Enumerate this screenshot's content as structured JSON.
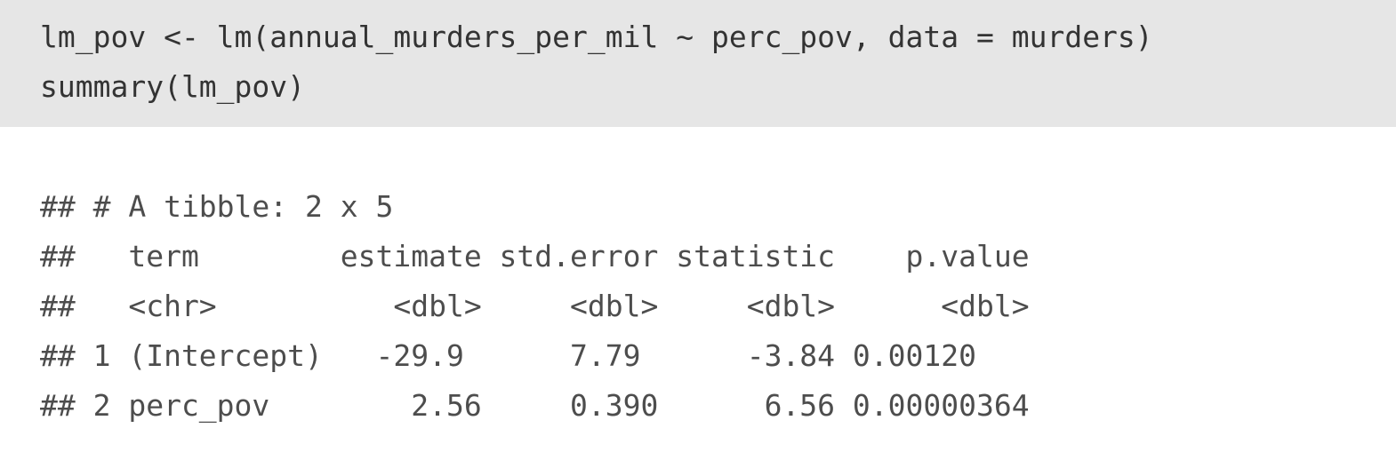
{
  "code": {
    "lines": [
      "lm_pov <- lm(annual_murders_per_mil ~ perc_pov, data = murders)",
      "summary(lm_pov)"
    ]
  },
  "output": {
    "lines": [
      "## # A tibble: 2 x 5",
      "##   term        estimate std.error statistic    p.value",
      "##   <chr>          <dbl>     <dbl>     <dbl>      <dbl>",
      "## 1 (Intercept)   -29.9      7.79      -3.84 0.00120",
      "## 2 perc_pov        2.56     0.390      6.56 0.00000364"
    ]
  },
  "colors": {
    "code_background": "#e6e6e6",
    "code_text": "#333333",
    "output_text": "#4d4d4d",
    "page_background": "#ffffff"
  }
}
